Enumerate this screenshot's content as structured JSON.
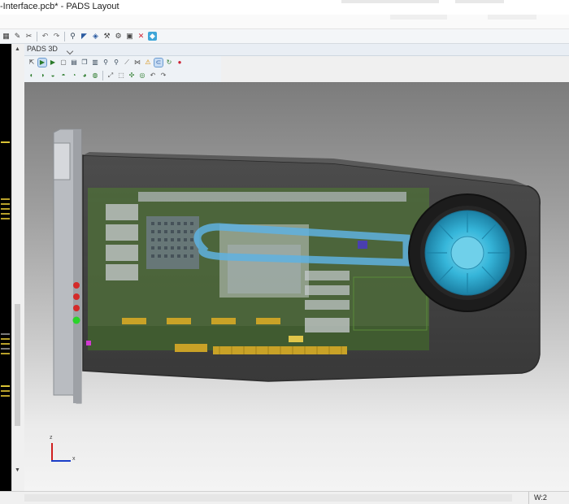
{
  "window": {
    "title": "-Interface.pcb* - PADS Layout"
  },
  "main_toolbar": {
    "icons": [
      "grid-icon",
      "pencil-icon",
      "cut-icon",
      "undo-icon",
      "redo-icon",
      "zoom-icon",
      "route-icon",
      "layer-icon",
      "tool-icon",
      "settings-icon",
      "view-icon",
      "close-icon",
      "board-3d-icon"
    ]
  },
  "pads3d": {
    "panel_title": "PADS 3D",
    "toolbar_row1_icons": [
      "select-icon",
      "play-icon",
      "play-next-icon",
      "box-icon",
      "save-icon",
      "copy-icon",
      "print-icon",
      "zoom-fit-icon",
      "zoom-area-icon",
      "measure-icon",
      "split-icon",
      "warning-icon",
      "magnet-icon",
      "rotate-icon",
      "stop-icon"
    ],
    "toolbar_row2_icons": [
      "view-front-icon",
      "view-back-icon",
      "view-left-icon",
      "view-right-icon",
      "view-top-icon",
      "view-bottom-icon",
      "view-iso-icon",
      "fit-icon",
      "frame-icon",
      "snap-icon",
      "hide-icon",
      "undo-view-icon",
      "redo-view-icon"
    ]
  },
  "axis_triad": {
    "x_label": "x",
    "z_label": "z"
  },
  "status": {
    "cell": "W:2"
  },
  "colors": {
    "fan_accent": "#2fb3d6",
    "heatpipe": "#5fb2e0",
    "pcb_green": "#4d6b3a",
    "gold": "#c9a227",
    "shroud": "#3a3a3a"
  }
}
